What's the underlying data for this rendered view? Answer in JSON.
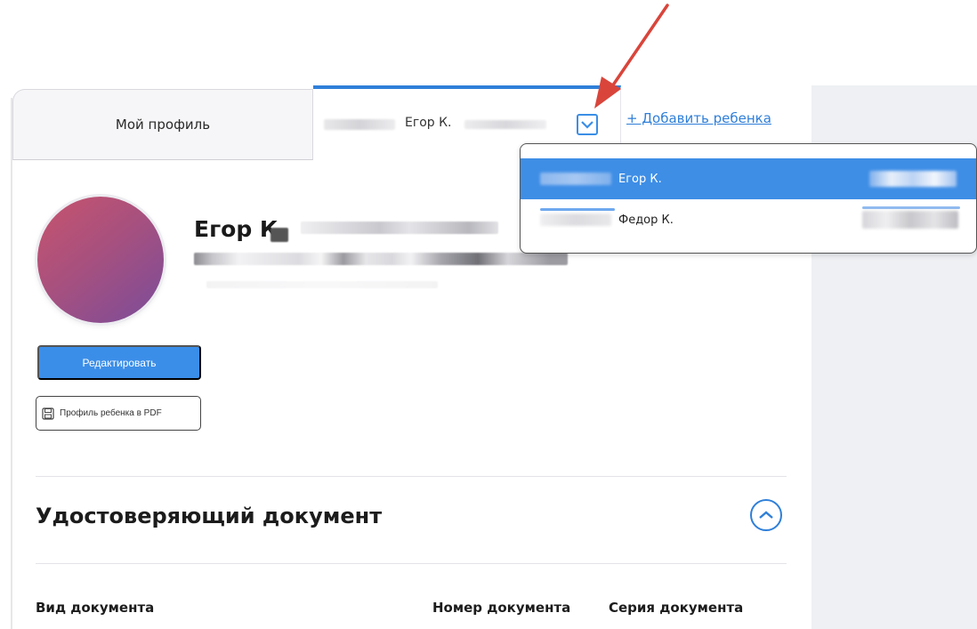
{
  "tabs": {
    "my_profile": "Мой профиль",
    "child_name": "Егор К.",
    "add_child": "+ Добавить ребенка"
  },
  "profile": {
    "name": "Егор К",
    "edit_button": "Редактировать",
    "pdf_button": "Профиль ребенка в PDF"
  },
  "document_section": {
    "title": "Удостоверяющий документ",
    "columns": [
      "Вид документа",
      "Номер документа",
      "Серия документа"
    ]
  },
  "dropdown": {
    "items": [
      {
        "label": "Егор К.",
        "selected": true
      },
      {
        "label": "Федор К.",
        "selected": false
      }
    ]
  },
  "colors": {
    "accent": "#2f7fd9",
    "button": "#3b8ee8",
    "selected_row": "#3e8ee6",
    "annotation_arrow": "#d9453b"
  },
  "icons": {
    "dropdown_toggle": "chevron-down-icon",
    "collapse": "chevron-up-icon",
    "pdf": "floppy-icon"
  }
}
